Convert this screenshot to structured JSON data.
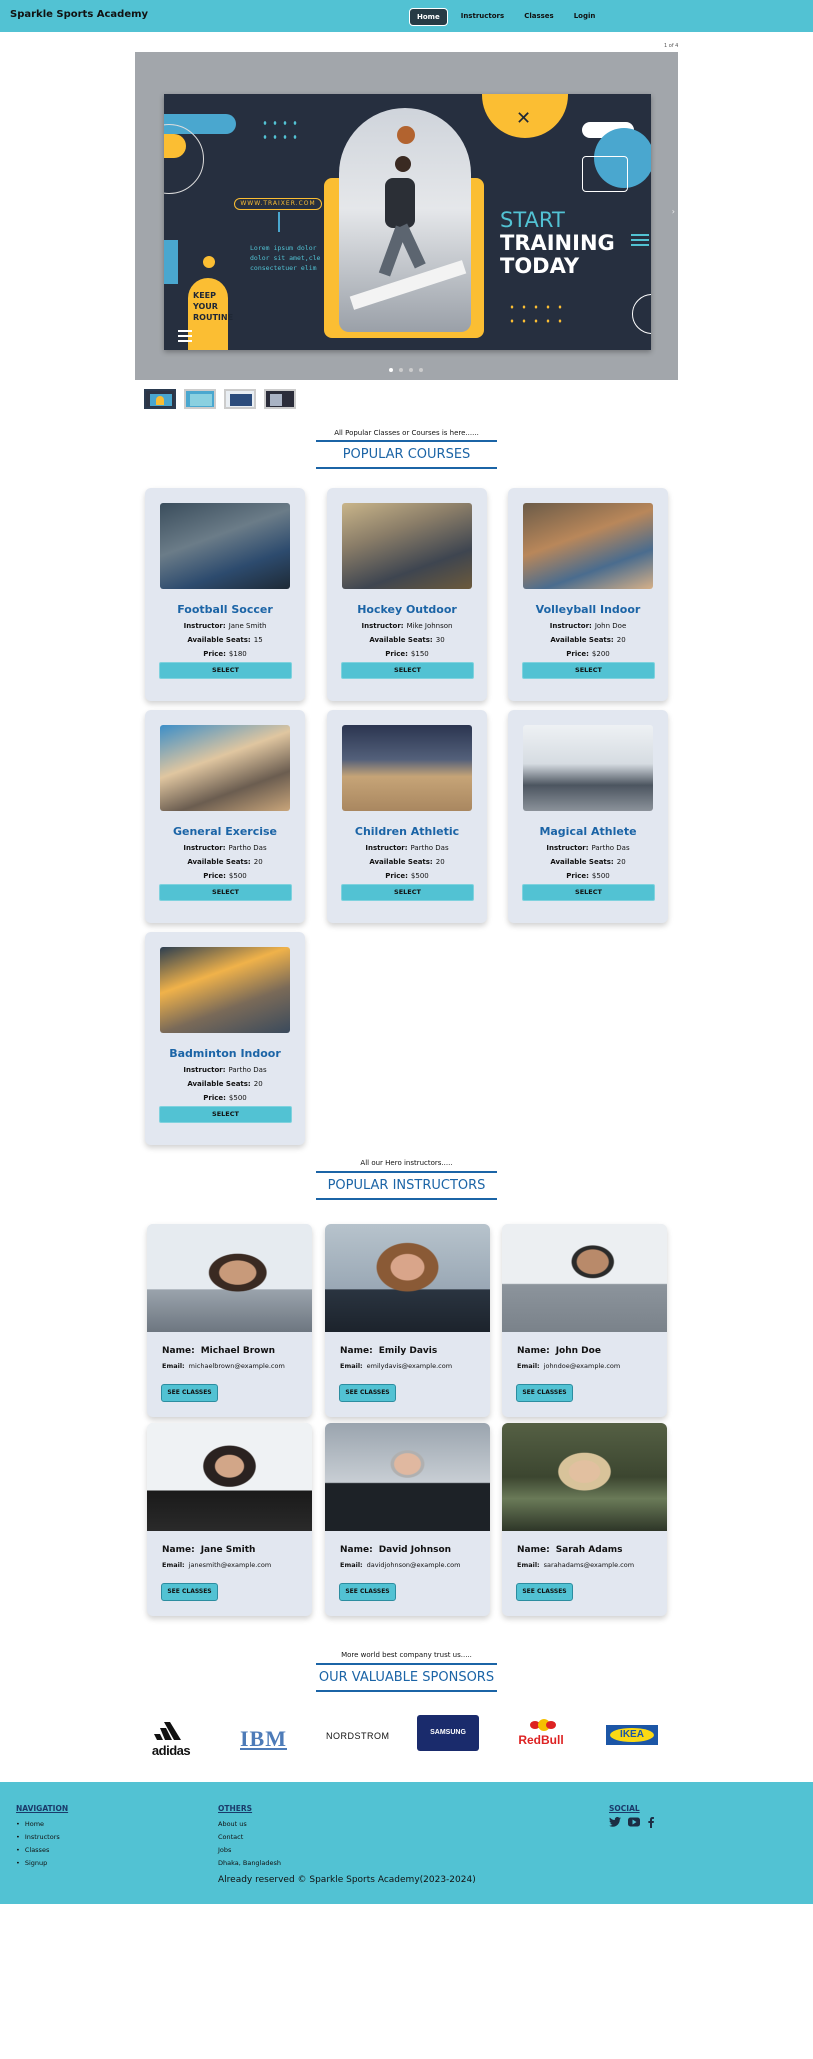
{
  "nav": {
    "brand": "Sparkle Sports Academy",
    "links": [
      "Home",
      "Instructors",
      "Classes",
      "Login"
    ]
  },
  "slider": {
    "counter": "1 of 4",
    "banner": {
      "url": "WWW.TRAIXER.COM",
      "lorem_lines": [
        "Lorem ipsum dolor",
        "dolor sit amet,cle",
        "consectetuer elim"
      ],
      "keep_lines": [
        "KEEP",
        "YOUR",
        "ROUTINE"
      ],
      "start": "START",
      "training": "TRAINING",
      "today": "TODAY"
    }
  },
  "courses": {
    "subtitle": "All Popular Classes or Courses is here......",
    "title": "POPULAR COURSES",
    "labels": {
      "instructor": "Instructor:",
      "seats": "Available Seats:",
      "price": "Price:",
      "button": "SELECT"
    },
    "items": [
      {
        "name": "Football Soccer",
        "instructor": "Jane Smith",
        "seats": "15",
        "price": "$180"
      },
      {
        "name": "Hockey Outdoor",
        "instructor": "Mike Johnson",
        "seats": "30",
        "price": "$150"
      },
      {
        "name": "Volleyball Indoor",
        "instructor": "John Doe",
        "seats": "20",
        "price": "$200"
      },
      {
        "name": "General Exercise",
        "instructor": "Partho Das",
        "seats": "20",
        "price": "$500"
      },
      {
        "name": "Children Athletic",
        "instructor": "Partho Das",
        "seats": "20",
        "price": "$500"
      },
      {
        "name": "Magical Athlete",
        "instructor": "Partho Das",
        "seats": "20",
        "price": "$500"
      },
      {
        "name": "Badminton Indoor",
        "instructor": "Partho Das",
        "seats": "20",
        "price": "$500"
      }
    ]
  },
  "instructors": {
    "subtitle": "All our Hero instructors.....",
    "title": "POPULAR INSTRUCTORS",
    "labels": {
      "name": "Name:",
      "email": "Email:",
      "button": "SEE CLASSES"
    },
    "items": [
      {
        "name": "Michael Brown",
        "email": "michaelbrown@example.com"
      },
      {
        "name": "Emily Davis",
        "email": "emilydavis@example.com"
      },
      {
        "name": "John Doe",
        "email": "johndoe@example.com"
      },
      {
        "name": "Jane Smith",
        "email": "janesmith@example.com"
      },
      {
        "name": "David Johnson",
        "email": "davidjohnson@example.com"
      },
      {
        "name": "Sarah Adams",
        "email": "sarahadams@example.com"
      }
    ]
  },
  "sponsors": {
    "subtitle": "More world best company trust us.....",
    "title": "OUR VALUABLE SPONSORS",
    "logos": [
      "adidas",
      "IBM",
      "NORDSTROM",
      "SAMSUNG",
      "RedBull",
      "IKEA"
    ]
  },
  "footer": {
    "nav_title": "NAVIGATION",
    "nav_links": [
      "Home",
      "Instructors",
      "Classes",
      "Signup"
    ],
    "others_title": "OTHERS",
    "others_links": [
      "About us",
      "Contact",
      "Jobs",
      "Dhaka, Bangladesh"
    ],
    "social_title": "SOCIAL",
    "social_icons": [
      "twitter-icon",
      "youtube-icon",
      "facebook-icon"
    ],
    "copyright": "Already reserved © Sparkle Sports Academy(2023-2024)"
  },
  "colors": {
    "primary": "#52c2d3",
    "accent": "#1b64a6",
    "card": "#e2e7f0",
    "dark": "#262f3f",
    "yellow": "#fbbe33"
  }
}
